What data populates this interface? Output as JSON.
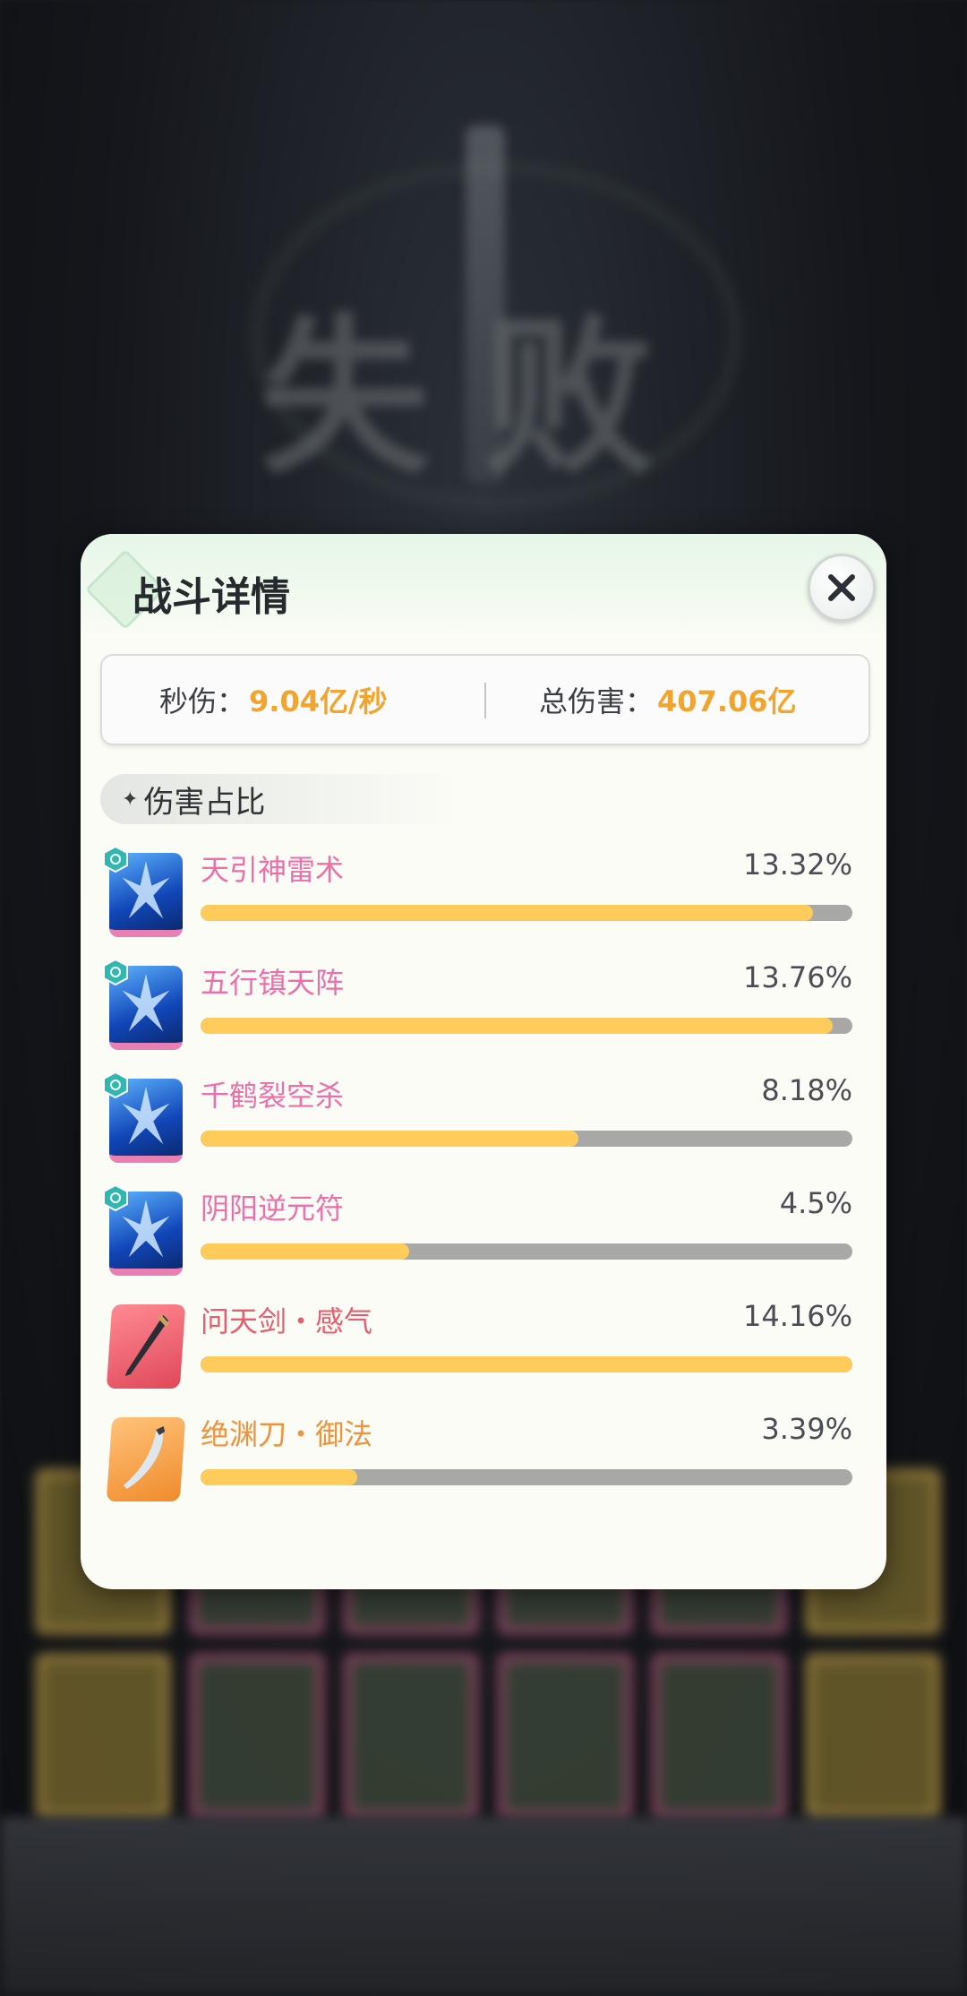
{
  "background": {
    "title": "失败"
  },
  "panel": {
    "title": "战斗详情",
    "stats": {
      "dps_label": "秒伤：",
      "dps_value": "9.04亿/秒",
      "total_label": "总伤害：",
      "total_value": "407.06亿"
    },
    "section_label": "伤害占比",
    "rows": [
      {
        "name": "天引神雷术",
        "percent": "13.32%",
        "fill": 0.94,
        "icon": "thunder-skill-icon",
        "type": "skill"
      },
      {
        "name": "五行镇天阵",
        "percent": "13.76%",
        "fill": 0.97,
        "icon": "five-elements-array-icon",
        "type": "skill"
      },
      {
        "name": "千鹤裂空杀",
        "percent": "8.18%",
        "fill": 0.58,
        "icon": "crane-strike-skill-icon",
        "type": "skill"
      },
      {
        "name": "阴阳逆元符",
        "percent": "4.5%",
        "fill": 0.32,
        "icon": "yin-yang-talisman-icon",
        "type": "skill"
      },
      {
        "name": "问天剑・感气",
        "percent": "14.16%",
        "fill": 1.0,
        "icon": "sword-weapon-icon",
        "type": "sword"
      },
      {
        "name": "绝渊刀・御法",
        "percent": "3.39%",
        "fill": 0.24,
        "icon": "blade-weapon-icon",
        "type": "blade"
      }
    ]
  },
  "colors": {
    "accent_value": "#f2a42d",
    "bar_fill": "#ffcb5a",
    "bar_track": "#a8a9a6",
    "skill_name": "#ee6fa8",
    "sword_name": "#e85d6d",
    "blade_name": "#f0923a"
  }
}
